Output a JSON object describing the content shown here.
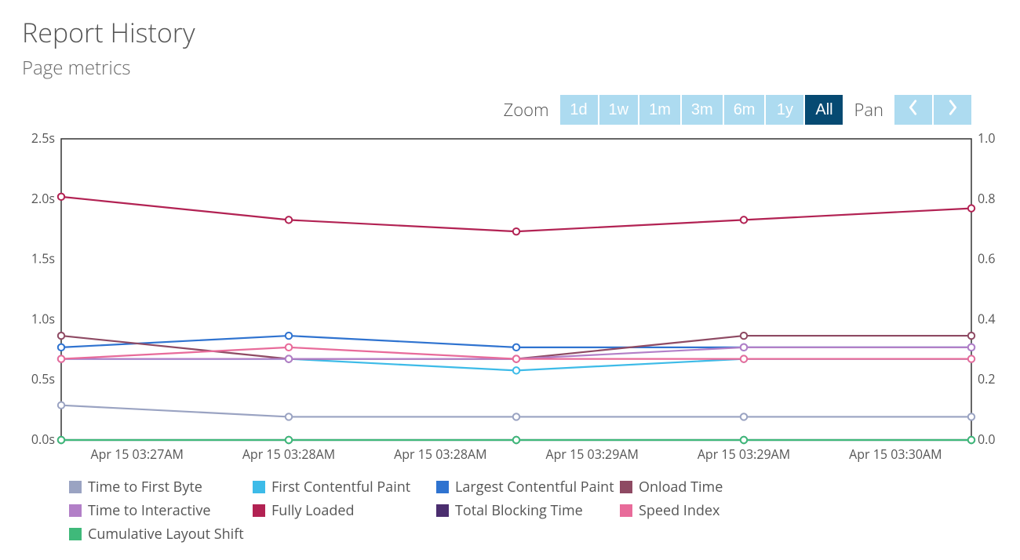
{
  "header": {
    "title": "Report History",
    "subtitle": "Page metrics"
  },
  "controls": {
    "zoom_label": "Zoom",
    "pan_label": "Pan",
    "zoom_options": [
      "1d",
      "1w",
      "1m",
      "3m",
      "6m",
      "1y",
      "All"
    ],
    "zoom_selected": "All"
  },
  "legend": [
    {
      "key": "ttfb",
      "label": "Time to First Byte",
      "color": "#9aa3c2"
    },
    {
      "key": "fcp",
      "label": "First Contentful Paint",
      "color": "#3dbbe8"
    },
    {
      "key": "lcp",
      "label": "Largest Contentful Paint",
      "color": "#2f73d0"
    },
    {
      "key": "onload",
      "label": "Onload Time",
      "color": "#8e4a63"
    },
    {
      "key": "tti",
      "label": "Time to Interactive",
      "color": "#b27fc7"
    },
    {
      "key": "fully",
      "label": "Fully Loaded",
      "color": "#b22253"
    },
    {
      "key": "tbt",
      "label": "Total Blocking Time",
      "color": "#4b2e6f"
    },
    {
      "key": "si",
      "label": "Speed Index",
      "color": "#e86b9a"
    },
    {
      "key": "cls",
      "label": "Cumulative Layout Shift",
      "color": "#3fb97a"
    }
  ],
  "chart_data": {
    "type": "line",
    "x_categories": [
      "Apr 15 03:27AM",
      "Apr 15 03:28AM",
      "Apr 15 03:28AM",
      "Apr 15 03:29AM",
      "Apr 15 03:29AM",
      "Apr 15 03:30AM"
    ],
    "y_left": {
      "label": "",
      "ticks": [
        "0.0s",
        "0.5s",
        "1.0s",
        "1.5s",
        "2.0s",
        "2.5s"
      ],
      "range": [
        0,
        2.6
      ]
    },
    "y_right": {
      "label": "",
      "ticks": [
        "0.0",
        "0.2",
        "0.4",
        "0.6",
        "0.8",
        "1.0"
      ],
      "range": [
        0,
        1.0
      ]
    },
    "x_data_points": 5,
    "series": [
      {
        "key": "ttfb",
        "name": "Time to First Byte",
        "axis": "left",
        "values": [
          0.3,
          0.2,
          0.2,
          0.2,
          0.2
        ]
      },
      {
        "key": "fcp",
        "name": "First Contentful Paint",
        "axis": "left",
        "values": [
          0.7,
          0.7,
          0.6,
          0.7,
          0.7
        ]
      },
      {
        "key": "lcp",
        "name": "Largest Contentful Paint",
        "axis": "left",
        "values": [
          0.8,
          0.9,
          0.8,
          0.8,
          0.8
        ]
      },
      {
        "key": "onload",
        "name": "Onload Time",
        "axis": "left",
        "values": [
          0.9,
          0.7,
          0.7,
          0.9,
          0.9
        ]
      },
      {
        "key": "tti",
        "name": "Time to Interactive",
        "axis": "left",
        "values": [
          0.7,
          0.7,
          0.7,
          0.8,
          0.8
        ]
      },
      {
        "key": "fully",
        "name": "Fully Loaded",
        "axis": "left",
        "values": [
          2.1,
          1.9,
          1.8,
          1.9,
          2.0
        ]
      },
      {
        "key": "tbt",
        "name": "Total Blocking Time",
        "axis": "left",
        "values": [
          0.0,
          0.0,
          0.0,
          0.0,
          0.0
        ]
      },
      {
        "key": "si",
        "name": "Speed Index",
        "axis": "left",
        "values": [
          0.7,
          0.8,
          0.7,
          0.7,
          0.7
        ]
      },
      {
        "key": "cls",
        "name": "Cumulative Layout Shift",
        "axis": "right",
        "values": [
          0.0,
          0.0,
          0.0,
          0.0,
          0.0
        ]
      }
    ]
  }
}
